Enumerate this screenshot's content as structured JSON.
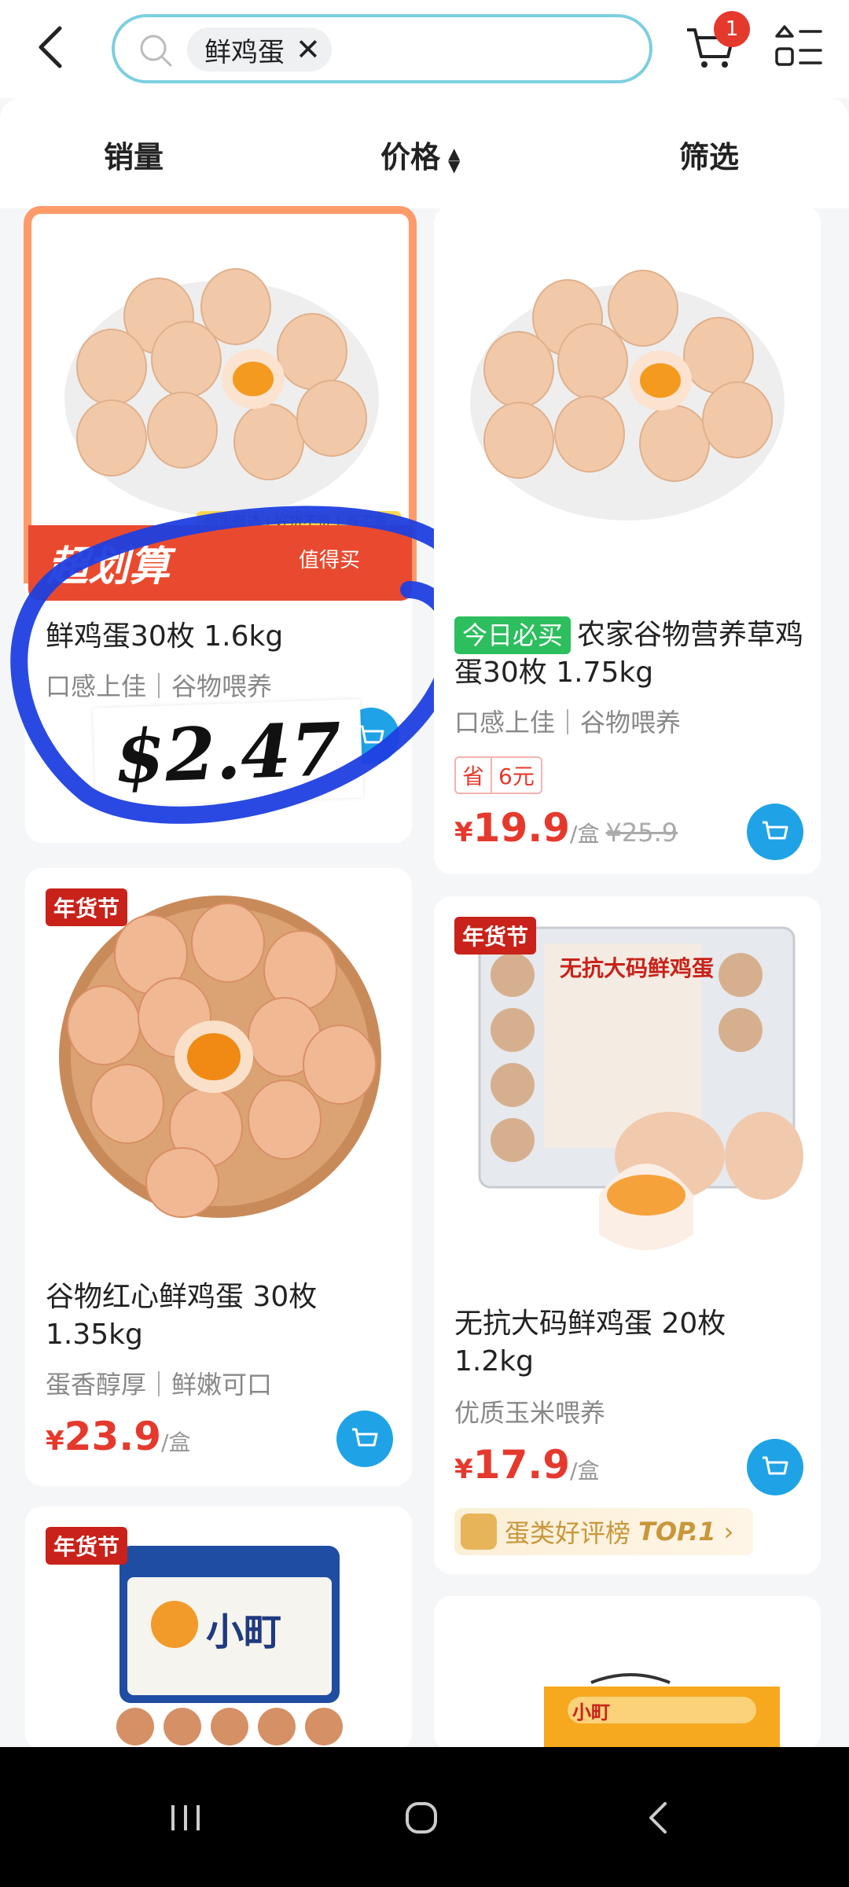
{
  "search": {
    "query": "鲜鸡蛋"
  },
  "cart": {
    "badge_count": "1"
  },
  "filters": {
    "sales": "销量",
    "price": "价格",
    "filter": "筛选"
  },
  "promo": {
    "banner_text": "超划算",
    "banner_right": "值得买",
    "strip_text": "邻里甄选 | 好货不贵 | 多买多省",
    "sticker_price": "$2.47"
  },
  "products": [
    {
      "title": "鲜鸡蛋30枚 1.6kg",
      "subtitle": "口感上佳｜谷物喂养"
    },
    {
      "badge": "今日必买",
      "title": "农家谷物营养草鸡蛋30枚 1.75kg",
      "subtitle": "口感上佳｜谷物喂养",
      "save_label": "省",
      "save_amount": "6元",
      "price_yen": "¥",
      "price": "19.9",
      "unit": "/盒",
      "orig_price": "¥25.9"
    },
    {
      "tag": "年货节",
      "title": "谷物红心鲜鸡蛋 30枚 1.35kg",
      "subtitle": "蛋香醇厚｜鲜嫩可口",
      "price_yen": "¥",
      "price": "23.9",
      "unit": "/盒"
    },
    {
      "tag": "年货节",
      "title": "无抗大码鲜鸡蛋 20枚 1.2kg",
      "subtitle": "优质玉米喂养",
      "price_yen": "¥",
      "price": "17.9",
      "unit": "/盒",
      "rank_text": "蛋类好评榜",
      "rank_value": "TOP.1",
      "package_title": "无抗大码鲜鸡蛋"
    },
    {
      "tag": "年货节",
      "package_title": "小町"
    },
    {
      "package_title": "小町"
    }
  ],
  "colors": {
    "accent_blue": "#1fa3e6",
    "price_red": "#e5392d",
    "search_border": "#7ccfe0"
  }
}
